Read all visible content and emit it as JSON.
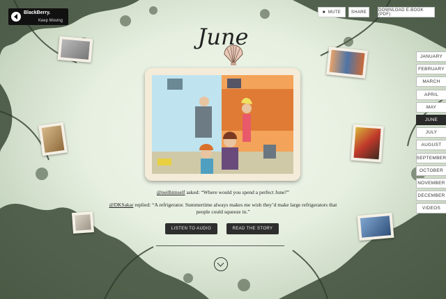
{
  "brand": {
    "name": "BlackBerry.",
    "tagline": "Keep Moving"
  },
  "toolbar": {
    "mute": "MUTE",
    "share": "SHARE",
    "download": "DOWNLOAD E-BOOK (PDF)"
  },
  "page": {
    "title": "June"
  },
  "story": {
    "asker": "@neilhimself",
    "asked_text": " asked: “Where would you spend a perfect June?”",
    "replier": "@DKSakar",
    "replied_text": " replied: “A refrigerator. Summertime always makes me wish they’d make large refrigerators that people could squeeze in.”"
  },
  "buttons": {
    "listen": "LISTEN TO AUDIO",
    "read": "READ THE STORY"
  },
  "months": [
    "JANUARY",
    "FEBRUARY",
    "MARCH",
    "APRIL",
    "MAY",
    "JUNE",
    "JULY",
    "AUGUST",
    "SEPTEMBER",
    "OCTOBER",
    "NOVEMBER",
    "DECEMBER",
    "VIDEOS"
  ],
  "active_month": "JUNE",
  "colors": {
    "accent_dark": "#2a2a2a",
    "frame": "#f4ecd8",
    "background": "#e6efe0"
  }
}
